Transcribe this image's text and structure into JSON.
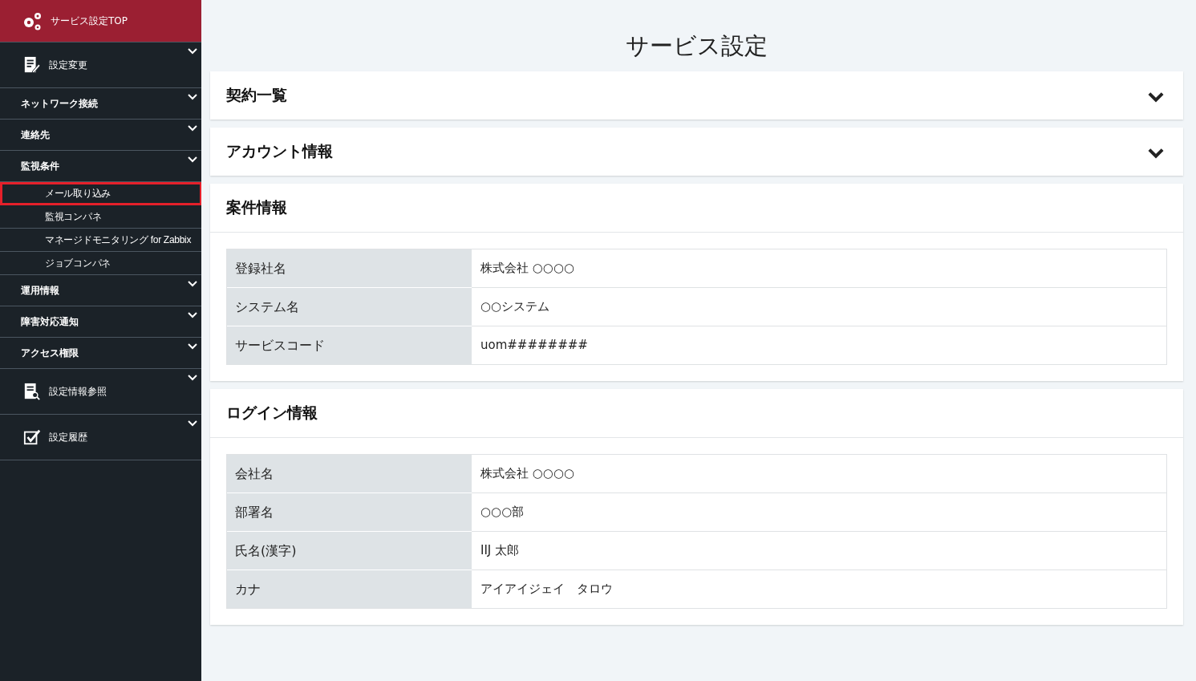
{
  "sidebar": {
    "items": [
      {
        "label": "サービス設定TOP",
        "kind": "gears",
        "selected": true
      },
      {
        "label": "設定変更",
        "kind": "edit",
        "selected": false
      },
      {
        "label": "ネットワーク接続",
        "kind": "plain",
        "selected": false
      },
      {
        "label": "連絡先",
        "kind": "plain",
        "selected": false
      },
      {
        "label": "監視条件",
        "kind": "plain",
        "selected": false,
        "children": [
          {
            "label": "メール取り込み",
            "highlighted": true
          },
          {
            "label": "監視コンパネ",
            "highlighted": false
          },
          {
            "label": "マネージドモニタリング for Zabbix",
            "highlighted": false
          },
          {
            "label": "ジョブコンパネ",
            "highlighted": false
          }
        ]
      },
      {
        "label": "運用情報",
        "kind": "plain",
        "selected": false
      },
      {
        "label": "障害対応通知",
        "kind": "plain",
        "selected": false
      },
      {
        "label": "アクセス権限",
        "kind": "plain",
        "selected": false
      },
      {
        "label": "設定情報参照",
        "kind": "lookup",
        "selected": false
      },
      {
        "label": "設定履歴",
        "kind": "history",
        "selected": false
      }
    ]
  },
  "main": {
    "title": "サービス設定",
    "panels": [
      {
        "title": "契約一覧",
        "expanded": false
      },
      {
        "title": "アカウント情報",
        "expanded": false
      },
      {
        "title": "案件情報",
        "expanded": true,
        "rows": [
          {
            "label": "登録社名",
            "value": "株式会社 ○○○○"
          },
          {
            "label": "システム名",
            "value": "○○システム"
          },
          {
            "label": "サービスコード",
            "value": "uom########"
          }
        ]
      },
      {
        "title": "ログイン情報",
        "expanded": true,
        "rows": [
          {
            "label": "会社名",
            "value": "株式会社 ○○○○"
          },
          {
            "label": "部署名",
            "value": "○○○部"
          },
          {
            "label": "氏名(漢字)",
            "value": "IIJ 太郎"
          },
          {
            "label": "カナ",
            "value": "アイアイジェイ　タロウ"
          }
        ]
      }
    ]
  }
}
